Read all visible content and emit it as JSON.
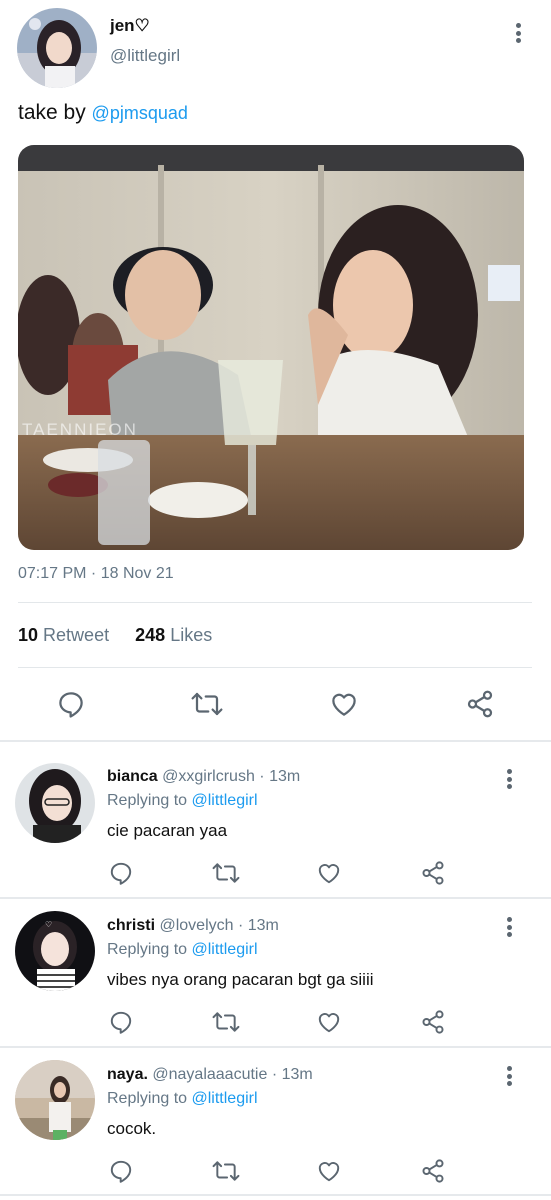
{
  "tweet": {
    "author_name": "jen♡",
    "author_handle": "@littlegirl",
    "text_prefix": "take by ",
    "mention": "@pjmsquad",
    "photo_watermark": "TAENNIEON",
    "timestamp": "07:17 PM · 18 Nov 21",
    "retweet_count": "10",
    "retweet_label": "Retweet",
    "likes_count": "248",
    "likes_label": "Likes"
  },
  "replies": [
    {
      "name": "bianca",
      "handle": "@xxgirlcrush",
      "time": "· 13m",
      "replying_label": "Replying to",
      "replying_to": "@littlegirl",
      "text": "cie pacaran yaa"
    },
    {
      "name": "christi",
      "handle": "@lovelych",
      "time": "· 13m",
      "replying_label": "Replying to",
      "replying_to": "@littlegirl",
      "text": "vibes nya orang pacaran bgt ga siiii"
    },
    {
      "name": "naya.",
      "handle": "@nayalaaacutie",
      "time": "· 13m",
      "replying_label": "Replying to",
      "replying_to": "@littlegirl",
      "text": "cocok."
    }
  ],
  "icons": {
    "reply": "speech-bubble-icon",
    "retweet": "retweet-icon",
    "like": "heart-icon",
    "share": "share-icon",
    "more": "more-vertical-icon"
  },
  "colors": {
    "link": "#1c9bef",
    "secondary_text": "#657786",
    "icon": "#5b6670",
    "divider": "#e3e7ea"
  }
}
